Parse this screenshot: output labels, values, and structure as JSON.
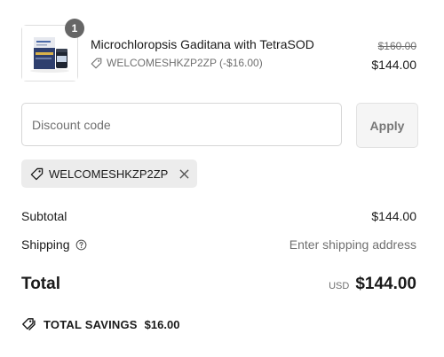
{
  "product": {
    "name": "Microchloropsis Gaditana with TetraSOD",
    "quantity": "1",
    "discount_code": "WELCOMESHKZP2ZP",
    "discount_amount": "(-$16.00)",
    "original_price": "$160.00",
    "price": "$144.00",
    "image_icon": "product-image"
  },
  "discount": {
    "placeholder": "Discount code",
    "apply_label": "Apply"
  },
  "applied_code": {
    "code": "WELCOMESHKZP2ZP",
    "remove_icon": "close-icon"
  },
  "summary": {
    "subtotal_label": "Subtotal",
    "subtotal_value": "$144.00",
    "shipping_label": "Shipping",
    "shipping_value": "Enter shipping address",
    "total_label": "Total",
    "currency": "USD",
    "total_value": "$144.00",
    "savings_label": "TOTAL SAVINGS",
    "savings_value": "$16.00"
  },
  "colors": {
    "text": "#1a1a1a",
    "muted": "#707070",
    "badge": "#666666",
    "tag_bg": "#ececec",
    "button_bg": "#f5f5f5"
  }
}
